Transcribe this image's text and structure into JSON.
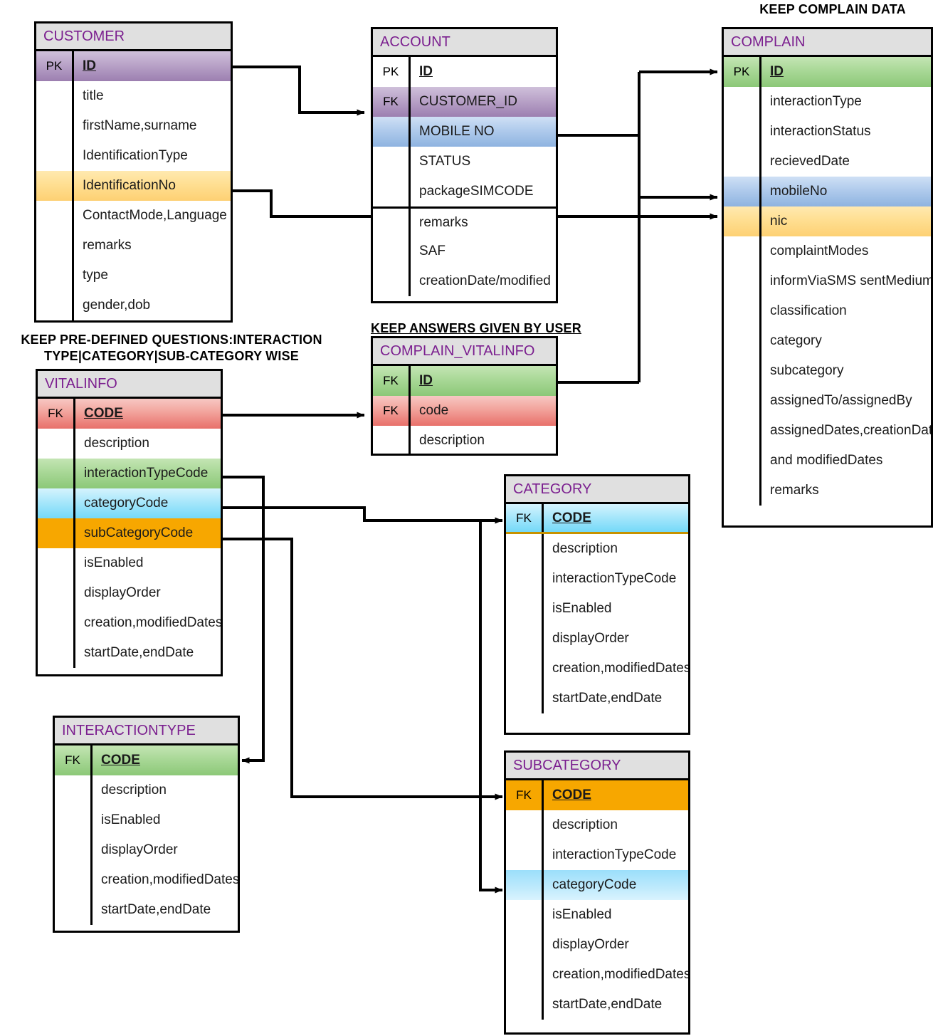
{
  "diagram": {
    "kind": "entity-relationship-diagram",
    "notes": [
      {
        "id": "note-complain",
        "text": "KEEP COMPLAIN DATA",
        "underline": false
      },
      {
        "id": "note-vitalinfo",
        "text": "KEEP PRE-DEFINED QUESTIONS:INTERACTION TYPE|CATEGORY|SUB-CATEGORY WISE",
        "underline": false
      },
      {
        "id": "note-complain-vitalinfo",
        "text": "KEEP ANSWERS GIVEN BY USER",
        "underline": true
      }
    ],
    "colors": {
      "title_text": "#7b1f8f",
      "title_bg": "#e0e0e0",
      "border": "#000000",
      "purple": "#b9a3c8",
      "green": "#a9d897",
      "blue": "#b0cbec",
      "yellow": "#ffdf92",
      "red": "#f2a39c",
      "cyan": "#a8e7fb",
      "orange": "#f7a700",
      "gold_rule": "#c79200"
    }
  },
  "entities": {
    "customer": {
      "name": "CUSTOMER",
      "rows": [
        {
          "key": "PK",
          "attr": "ID",
          "fill": "purple",
          "pk": true
        },
        {
          "key": "",
          "attr": "title",
          "fill": "none",
          "pk": false
        },
        {
          "key": "",
          "attr": "firstName,surname",
          "fill": "none",
          "pk": false
        },
        {
          "key": "",
          "attr": "IdentificationType",
          "fill": "none",
          "pk": false
        },
        {
          "key": "",
          "attr": "IdentificationNo",
          "fill": "yellow",
          "pk": false
        },
        {
          "key": "",
          "attr": "ContactMode,Language",
          "fill": "none",
          "pk": false
        },
        {
          "key": "",
          "attr": "remarks",
          "fill": "none",
          "pk": false
        },
        {
          "key": "",
          "attr": "type",
          "fill": "none",
          "pk": false
        },
        {
          "key": "",
          "attr": "gender,dob",
          "fill": "none",
          "pk": false
        }
      ]
    },
    "account": {
      "name": "ACCOUNT",
      "rows": [
        {
          "key": "PK",
          "attr": "ID",
          "fill": "none",
          "pk": true
        },
        {
          "key": "FK",
          "attr": "CUSTOMER_ID",
          "fill": "purple",
          "pk": false
        },
        {
          "key": "",
          "attr": "MOBILE NO",
          "fill": "blue",
          "pk": false
        },
        {
          "key": "",
          "attr": "STATUS",
          "fill": "none",
          "pk": false
        },
        {
          "key": "",
          "attr": "packageSIMCODE",
          "fill": "none",
          "pk": false
        },
        {
          "key": "",
          "attr": "remarks",
          "fill": "none",
          "pk": false,
          "rule_above": true
        },
        {
          "key": "",
          "attr": "SAF",
          "fill": "none",
          "pk": false
        },
        {
          "key": "",
          "attr": "creationDate/modified",
          "fill": "none",
          "pk": false
        }
      ]
    },
    "complain": {
      "name": "COMPLAIN",
      "rows": [
        {
          "key": "PK",
          "attr": "ID",
          "fill": "green",
          "pk": true
        },
        {
          "key": "",
          "attr": "interactionType",
          "fill": "none",
          "pk": false
        },
        {
          "key": "",
          "attr": "interactionStatus",
          "fill": "none",
          "pk": false
        },
        {
          "key": "",
          "attr": "recievedDate",
          "fill": "none",
          "pk": false
        },
        {
          "key": "",
          "attr": "mobileNo",
          "fill": "blue",
          "pk": false
        },
        {
          "key": "",
          "attr": "nic",
          "fill": "yellow",
          "pk": false
        },
        {
          "key": "",
          "attr": "complaintModes",
          "fill": "none",
          "pk": false
        },
        {
          "key": "",
          "attr": "informViaSMS sentMedium",
          "fill": "none",
          "pk": false
        },
        {
          "key": "",
          "attr": "classification",
          "fill": "none",
          "pk": false
        },
        {
          "key": "",
          "attr": "category",
          "fill": "none",
          "pk": false
        },
        {
          "key": "",
          "attr": "subcategory",
          "fill": "none",
          "pk": false
        },
        {
          "key": "",
          "attr": "assignedTo/assignedBy",
          "fill": "none",
          "pk": false
        },
        {
          "key": "",
          "attr": "assignedDates,creationDates",
          "fill": "none",
          "pk": false
        },
        {
          "key": "",
          "attr": "and modifiedDates",
          "fill": "none",
          "pk": false
        },
        {
          "key": "",
          "attr": "remarks",
          "fill": "none",
          "pk": false
        }
      ]
    },
    "vitalinfo": {
      "name": "VITALINFO",
      "rows": [
        {
          "key": "FK",
          "attr": "CODE",
          "fill": "red",
          "pk": true
        },
        {
          "key": "",
          "attr": "description",
          "fill": "none",
          "pk": false
        },
        {
          "key": "",
          "attr": "interactionTypeCode",
          "fill": "green",
          "pk": false
        },
        {
          "key": "",
          "attr": "categoryCode",
          "fill": "cyan",
          "pk": false
        },
        {
          "key": "",
          "attr": "subCategoryCode",
          "fill": "orange",
          "pk": false
        },
        {
          "key": "",
          "attr": "isEnabled",
          "fill": "none",
          "pk": false
        },
        {
          "key": "",
          "attr": "displayOrder",
          "fill": "none",
          "pk": false
        },
        {
          "key": "",
          "attr": "creation,modifiedDates",
          "fill": "none",
          "pk": false
        },
        {
          "key": "",
          "attr": "startDate,endDate",
          "fill": "none",
          "pk": false
        }
      ]
    },
    "complain_vitalinfo": {
      "name": "COMPLAIN_VITALINFO",
      "rows": [
        {
          "key": "FK",
          "attr": "ID",
          "fill": "green",
          "pk": true
        },
        {
          "key": "FK",
          "attr": "code",
          "fill": "red",
          "pk": false
        },
        {
          "key": "",
          "attr": "description",
          "fill": "none",
          "pk": false
        }
      ]
    },
    "category": {
      "name": "CATEGORY",
      "rows": [
        {
          "key": "FK",
          "attr": "CODE",
          "fill": "cyan",
          "pk": true,
          "gold_rule": true
        },
        {
          "key": "",
          "attr": "description",
          "fill": "none",
          "pk": false
        },
        {
          "key": "",
          "attr": "interactionTypeCode",
          "fill": "none",
          "pk": false
        },
        {
          "key": "",
          "attr": "isEnabled",
          "fill": "none",
          "pk": false
        },
        {
          "key": "",
          "attr": "displayOrder",
          "fill": "none",
          "pk": false
        },
        {
          "key": "",
          "attr": "creation,modifiedDates",
          "fill": "none",
          "pk": false
        },
        {
          "key": "",
          "attr": "startDate,endDate",
          "fill": "none",
          "pk": false
        }
      ]
    },
    "subcategory": {
      "name": "SUBCATEGORY",
      "rows": [
        {
          "key": "FK",
          "attr": "CODE",
          "fill": "orange",
          "pk": true
        },
        {
          "key": "",
          "attr": "description",
          "fill": "none",
          "pk": false
        },
        {
          "key": "",
          "attr": "interactionTypeCode",
          "fill": "none",
          "pk": false
        },
        {
          "key": "",
          "attr": "categoryCode",
          "fill": "cyan-flat",
          "pk": false
        },
        {
          "key": "",
          "attr": "isEnabled",
          "fill": "none",
          "pk": false
        },
        {
          "key": "",
          "attr": "displayOrder",
          "fill": "none",
          "pk": false
        },
        {
          "key": "",
          "attr": "creation,modifiedDates",
          "fill": "none",
          "pk": false
        },
        {
          "key": "",
          "attr": "startDate,endDate",
          "fill": "none",
          "pk": false
        }
      ]
    },
    "interactiontype": {
      "name": "INTERACTIONTYPE",
      "rows": [
        {
          "key": "FK",
          "attr": "CODE",
          "fill": "green",
          "pk": true
        },
        {
          "key": "",
          "attr": "description",
          "fill": "none",
          "pk": false
        },
        {
          "key": "",
          "attr": "isEnabled",
          "fill": "none",
          "pk": false
        },
        {
          "key": "",
          "attr": "displayOrder",
          "fill": "none",
          "pk": false
        },
        {
          "key": "",
          "attr": "creation,modifiedDates",
          "fill": "none",
          "pk": false
        },
        {
          "key": "",
          "attr": "startDate,endDate",
          "fill": "none",
          "pk": false
        }
      ]
    }
  },
  "relationships": [
    {
      "from": "CUSTOMER.ID",
      "to": "ACCOUNT.CUSTOMER_ID"
    },
    {
      "from": "CUSTOMER.IdentificationNo",
      "to": "COMPLAIN.nic"
    },
    {
      "from": "ACCOUNT.MOBILE NO",
      "to": "COMPLAIN.mobileNo"
    },
    {
      "from": "COMPLAIN_VITALINFO.ID",
      "to": "COMPLAIN.ID"
    },
    {
      "from": "VITALINFO.CODE",
      "to": "COMPLAIN_VITALINFO.code"
    },
    {
      "from": "VITALINFO.interactionTypeCode",
      "to": "INTERACTIONTYPE.CODE"
    },
    {
      "from": "VITALINFO.categoryCode",
      "to": "CATEGORY.CODE"
    },
    {
      "from": "VITALINFO.subCategoryCode",
      "to": "SUBCATEGORY.CODE"
    },
    {
      "from": "CATEGORY.CODE",
      "to": "SUBCATEGORY.categoryCode"
    }
  ]
}
